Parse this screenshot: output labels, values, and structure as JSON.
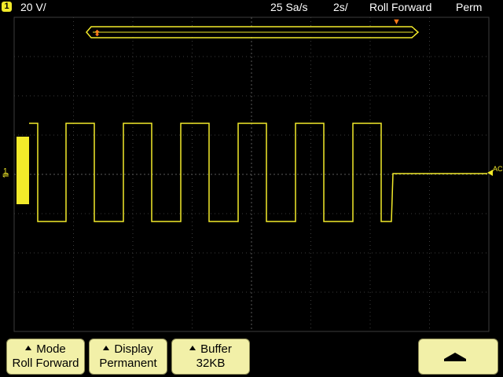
{
  "status": {
    "channel_number": "1",
    "volts_per_div": "20 V/",
    "sample_rate": "25 Sa/s",
    "time_per_div": "2s/",
    "acquire_mode": "Roll Forward",
    "persistence": "Perm"
  },
  "markers": {
    "channel_marker": "1",
    "trigger_level_label": "AC"
  },
  "softkeys": [
    {
      "title": "Mode",
      "value": "Roll Forward"
    },
    {
      "title": "Display",
      "value": "Permanent"
    },
    {
      "title": "Buffer",
      "value": "32KB"
    }
  ],
  "colors": {
    "trace": "#f2ea2a",
    "grid": "#3c3c3c",
    "softkey_bg": "#f2f0a8",
    "trigger_marker": "#ff7a1a"
  },
  "waveform": {
    "type": "square",
    "pulses": 7,
    "signal_ends_flat": true
  }
}
